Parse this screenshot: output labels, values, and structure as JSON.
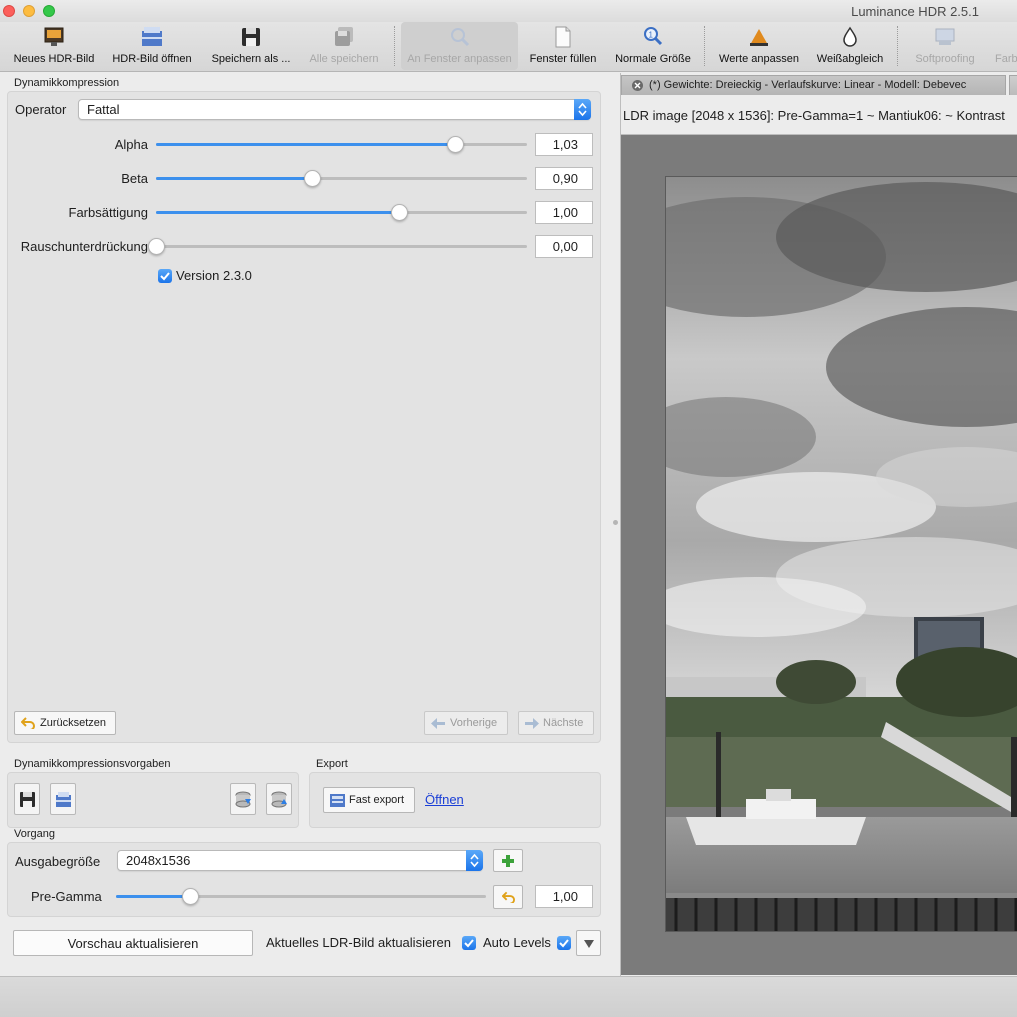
{
  "window": {
    "title": "Luminance HDR 2.5.1"
  },
  "toolbar": {
    "items": [
      {
        "label": "Neues HDR-Bild",
        "icon": "new-hdr-icon",
        "enabled": true
      },
      {
        "label": "HDR-Bild öffnen",
        "icon": "open-hdr-icon",
        "enabled": true
      },
      {
        "label": "Speichern als ...",
        "icon": "save-as-icon",
        "enabled": true
      },
      {
        "label": "Alle speichern",
        "icon": "save-all-icon",
        "enabled": false
      },
      {
        "label": "An Fenster anpassen",
        "icon": "fit-window-icon",
        "enabled": false
      },
      {
        "label": "Fenster füllen",
        "icon": "fill-window-icon",
        "enabled": true
      },
      {
        "label": "Normale Größe",
        "icon": "normal-size-icon",
        "enabled": true
      },
      {
        "label": "Werte anpassen",
        "icon": "levels-icon",
        "enabled": true
      },
      {
        "label": "Weißabgleich",
        "icon": "white-balance-icon",
        "enabled": true
      },
      {
        "label": "Softproofing",
        "icon": "softproofing-icon",
        "enabled": false
      },
      {
        "label": "Farb",
        "icon": "gamut-check-icon",
        "enabled": false
      }
    ]
  },
  "tonemapping": {
    "group_title": "Dynamikkompression",
    "operator_label": "Operator",
    "operator_value": "Fattal",
    "params": [
      {
        "label": "Alpha",
        "value": "1,03",
        "fraction": 0.807
      },
      {
        "label": "Beta",
        "value": "0,90",
        "fraction": 0.421
      },
      {
        "label": "Farbsättigung",
        "value": "1,00",
        "fraction": 0.654
      },
      {
        "label": "Rauschunterdrückung",
        "value": "0,00",
        "fraction": 0.0
      }
    ],
    "version_checkbox": {
      "label": "Version 2.3.0",
      "checked": true
    },
    "reset_label": "Zurücksetzen",
    "prev_label": "Vorherige",
    "next_label": "Nächste"
  },
  "presets": {
    "group_title": "Dynamikkompressionsvorgaben"
  },
  "export": {
    "group_title": "Export",
    "fast_export_label": "Fast export",
    "open_link": "Öffnen"
  },
  "process": {
    "group_title": "Vorgang",
    "output_size_label": "Ausgabegröße",
    "output_size_value": "2048x1536",
    "pregamma_label": "Pre-Gamma",
    "pregamma_value": "1,00",
    "pregamma_fraction": 0.2
  },
  "bottom": {
    "update_preview_label": "Vorschau aktualisieren",
    "update_ldr_label": "Aktuelles LDR-Bild aktualisieren",
    "update_ldr_checked": true,
    "auto_levels_label": "Auto Levels",
    "auto_levels_checked": true
  },
  "viewer": {
    "tab_label": "(*) Gewichte: Dreieckig - Verlaufskurve: Linear - Modell: Debevec",
    "info_text": "LDR image [2048 x 1536]: Pre-Gamma=1 ~ Mantiuk06: ~ Kontrast"
  },
  "colors": {
    "accent": "#1b74ea",
    "slider_fill": "#3c90ed",
    "viewer_bg": "#7b7b7b"
  }
}
